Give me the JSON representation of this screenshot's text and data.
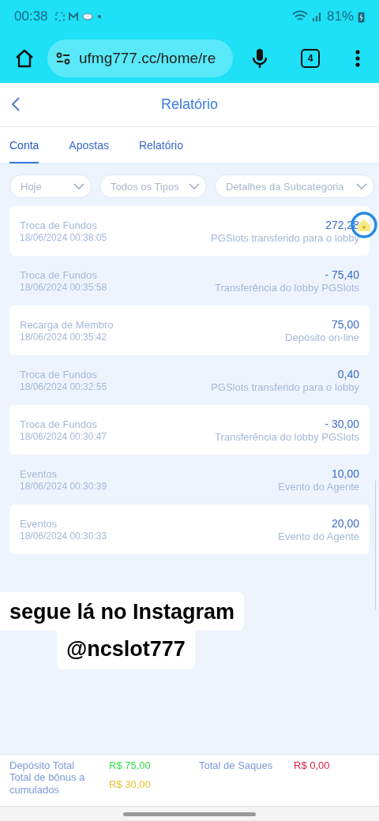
{
  "status_bar": {
    "time": "00:38",
    "battery": "81%"
  },
  "browser": {
    "url": "ufmg777.cc/home/re",
    "tab_count": "4"
  },
  "header": {
    "title": "Relatório"
  },
  "tabs": [
    {
      "label": "Conta",
      "selected": true
    },
    {
      "label": "Apostas",
      "selected": false
    },
    {
      "label": "Relatório",
      "selected": false
    }
  ],
  "filters": [
    {
      "value": "Hoje"
    },
    {
      "value": "Todos os Tipos"
    },
    {
      "value": "Detalhes da Subcategoria"
    }
  ],
  "transactions": [
    {
      "type": "Troca de Fundos",
      "datetime": "18/06/2024 00:38:05",
      "amount": "272,28",
      "description": "PGSlots transferido para o lobby"
    },
    {
      "type": "Troca de Fundos",
      "datetime": "18/06/2024 00:35:58",
      "amount": "- 75,40",
      "description": "Transferência do lobby PGSlots"
    },
    {
      "type": "Recarga de Membro",
      "datetime": "18/06/2024 00:35:42",
      "amount": "75,00",
      "description": "Depósito on-line"
    },
    {
      "type": "Troca de Fundos",
      "datetime": "18/06/2024 00:32:55",
      "amount": "0,40",
      "description": "PGSlots transferido para o lobby"
    },
    {
      "type": "Troca de Fundos",
      "datetime": "18/06/2024 00:30:47",
      "amount": "- 30,00",
      "description": "Transferência do lobby PGSlots"
    },
    {
      "type": "Eventos",
      "datetime": "18/06/2024 00:30:39",
      "amount": "10,00",
      "description": "Evento do Agente"
    },
    {
      "type": "Eventos",
      "datetime": "18/06/2024 00:30:33",
      "amount": "20,00",
      "description": "Evento do Agente"
    }
  ],
  "caption": {
    "line_1": "segue lá no Instagram",
    "line_2": "@ncslot777"
  },
  "totals": [
    {
      "label": "Depósito Total",
      "value": "R$ 75,00",
      "color": "#33dd44"
    },
    {
      "label": "Total de Saques",
      "value": "R$ 0,00",
      "color": "#dd2244"
    },
    {
      "label": "Total de bônus a cumulados",
      "value": "R$ 30,00",
      "color": "#e8c030"
    }
  ]
}
